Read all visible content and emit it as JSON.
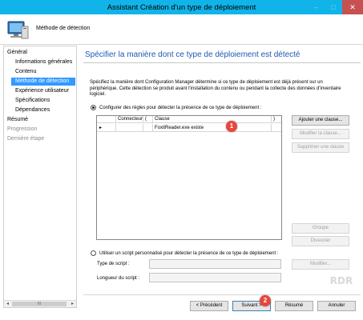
{
  "window": {
    "title": "Assistant Création d'un type de déploiement",
    "minimize_icon": "minimize-icon",
    "maximize_icon": "maximize-icon",
    "close_icon": "close-icon"
  },
  "header": {
    "title": "Méthode de détection",
    "icon": "computer-wizard-icon"
  },
  "sidebar": {
    "items": [
      {
        "label": "Général",
        "state": "normal"
      },
      {
        "label": "Informations générales",
        "state": "normal"
      },
      {
        "label": "Contenu",
        "state": "normal"
      },
      {
        "label": "Méthode de détection",
        "state": "selected"
      },
      {
        "label": "Expérience utilisateur",
        "state": "normal"
      },
      {
        "label": "Spécifications",
        "state": "normal"
      },
      {
        "label": "Dépendances",
        "state": "normal"
      },
      {
        "label": "Résumé",
        "state": "normal"
      },
      {
        "label": "Progression",
        "state": "dim"
      },
      {
        "label": "Dernière étape",
        "state": "dim"
      }
    ],
    "scroll_thumb": "III"
  },
  "main": {
    "title": "Spécifier la manière dont ce type de déploiement est détecté",
    "description": "Spécifiez la manière dont Configuration Manager détermine si ce type de déploiement est déjà présent sur un périphérique. Cette détection se produit avant l'installation du contenu ou pendant la collecte des données d'inventaire logiciel.",
    "option_rules": "Configurer des règles pour détecter la présence de ce type de déploiement :",
    "option_script": "Utiliser un script personnalisé pour détecter la présence de ce type de déploiement :",
    "grid": {
      "columns": [
        "Connecteur",
        "(",
        "Clause",
        ")"
      ],
      "rows": [
        {
          "selector": "▸",
          "connector": "",
          "open": "",
          "clause": "FoxitReader.exe existe",
          "close": ""
        }
      ]
    },
    "buttons": {
      "add_clause": "Ajouter une clause...",
      "modify_clause": "Modifier la clause...",
      "delete_clause": "Supprimer une clause",
      "group": "Groupe",
      "ungroup": "Dissocier",
      "modify": "Modifier..."
    },
    "script_type_label": "Type de script :",
    "script_length_label": "Longueur du script :"
  },
  "footer": {
    "previous": "< Précédent",
    "next": "Suivant >",
    "summary": "Résumé",
    "cancel": "Annuler"
  },
  "annotations": {
    "badge1": "1",
    "badge2": "2"
  },
  "colors": {
    "titlebar": "#11b4e8",
    "selected": "#3399ff",
    "heading": "#1c5ab4",
    "badge": "#e8463c"
  }
}
